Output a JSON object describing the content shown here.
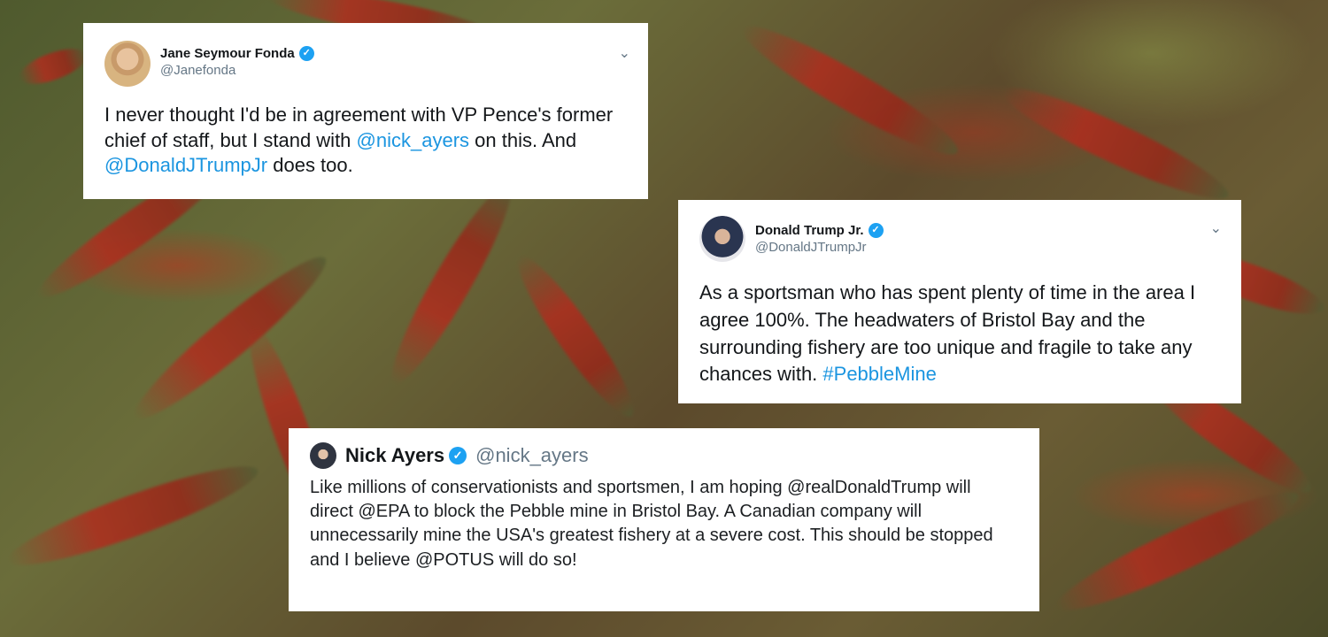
{
  "tweets": [
    {
      "name": "Jane Seymour Fonda",
      "handle": "@Janefonda",
      "verified_mark": "✓",
      "menu_icon": "⌄",
      "text": {
        "a": "I never thought I'd be in agreement with VP Pence's former chief of staff, but I stand with ",
        "mention1": "@nick_ayers",
        "b": " on this. And ",
        "mention2": "@DonaldJTrumpJr",
        "c": " does too."
      }
    },
    {
      "name": "Donald Trump Jr.",
      "handle": "@DonaldJTrumpJr",
      "verified_mark": "✓",
      "menu_icon": "⌄",
      "text": {
        "a": "As a sportsman who has spent plenty of time in the area I agree 100%. The headwaters of Bristol Bay and the surrounding fishery are too unique and fragile to take any chances with. ",
        "hashtag": "#PebbleMine"
      }
    },
    {
      "name": "Nick Ayers",
      "handle": "@nick_ayers",
      "verified_mark": "✓",
      "text": "Like millions of conservationists and sportsmen, I am hoping @realDonaldTrump will direct @EPA to block the Pebble mine in Bristol Bay. A Canadian company will unnecessarily mine the USA's greatest fishery at a severe cost. This should be stopped and I believe @POTUS will do so!"
    }
  ],
  "colors": {
    "link": "#1b95e0",
    "verified": "#1da1f2",
    "handle": "#657786",
    "text": "#14171a"
  }
}
